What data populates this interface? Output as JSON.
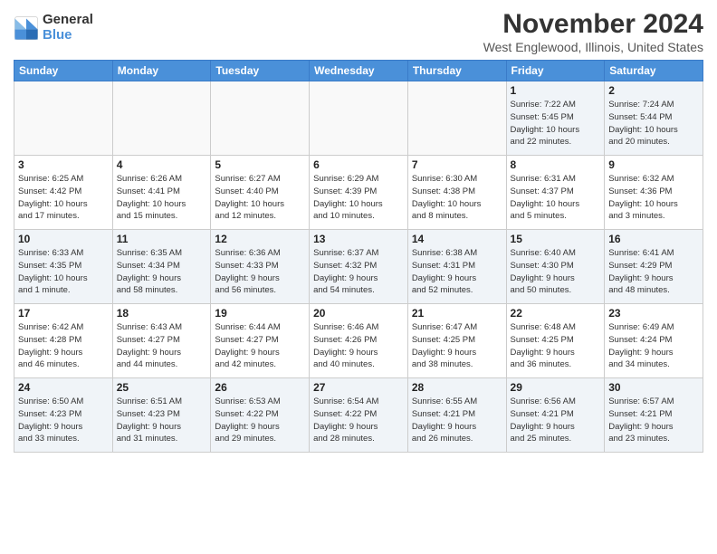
{
  "logo": {
    "general": "General",
    "blue": "Blue"
  },
  "title": "November 2024",
  "location": "West Englewood, Illinois, United States",
  "headers": [
    "Sunday",
    "Monday",
    "Tuesday",
    "Wednesday",
    "Thursday",
    "Friday",
    "Saturday"
  ],
  "weeks": [
    [
      {
        "day": "",
        "info": ""
      },
      {
        "day": "",
        "info": ""
      },
      {
        "day": "",
        "info": ""
      },
      {
        "day": "",
        "info": ""
      },
      {
        "day": "",
        "info": ""
      },
      {
        "day": "1",
        "info": "Sunrise: 7:22 AM\nSunset: 5:45 PM\nDaylight: 10 hours\nand 22 minutes."
      },
      {
        "day": "2",
        "info": "Sunrise: 7:24 AM\nSunset: 5:44 PM\nDaylight: 10 hours\nand 20 minutes."
      }
    ],
    [
      {
        "day": "3",
        "info": "Sunrise: 6:25 AM\nSunset: 4:42 PM\nDaylight: 10 hours\nand 17 minutes."
      },
      {
        "day": "4",
        "info": "Sunrise: 6:26 AM\nSunset: 4:41 PM\nDaylight: 10 hours\nand 15 minutes."
      },
      {
        "day": "5",
        "info": "Sunrise: 6:27 AM\nSunset: 4:40 PM\nDaylight: 10 hours\nand 12 minutes."
      },
      {
        "day": "6",
        "info": "Sunrise: 6:29 AM\nSunset: 4:39 PM\nDaylight: 10 hours\nand 10 minutes."
      },
      {
        "day": "7",
        "info": "Sunrise: 6:30 AM\nSunset: 4:38 PM\nDaylight: 10 hours\nand 8 minutes."
      },
      {
        "day": "8",
        "info": "Sunrise: 6:31 AM\nSunset: 4:37 PM\nDaylight: 10 hours\nand 5 minutes."
      },
      {
        "day": "9",
        "info": "Sunrise: 6:32 AM\nSunset: 4:36 PM\nDaylight: 10 hours\nand 3 minutes."
      }
    ],
    [
      {
        "day": "10",
        "info": "Sunrise: 6:33 AM\nSunset: 4:35 PM\nDaylight: 10 hours\nand 1 minute."
      },
      {
        "day": "11",
        "info": "Sunrise: 6:35 AM\nSunset: 4:34 PM\nDaylight: 9 hours\nand 58 minutes."
      },
      {
        "day": "12",
        "info": "Sunrise: 6:36 AM\nSunset: 4:33 PM\nDaylight: 9 hours\nand 56 minutes."
      },
      {
        "day": "13",
        "info": "Sunrise: 6:37 AM\nSunset: 4:32 PM\nDaylight: 9 hours\nand 54 minutes."
      },
      {
        "day": "14",
        "info": "Sunrise: 6:38 AM\nSunset: 4:31 PM\nDaylight: 9 hours\nand 52 minutes."
      },
      {
        "day": "15",
        "info": "Sunrise: 6:40 AM\nSunset: 4:30 PM\nDaylight: 9 hours\nand 50 minutes."
      },
      {
        "day": "16",
        "info": "Sunrise: 6:41 AM\nSunset: 4:29 PM\nDaylight: 9 hours\nand 48 minutes."
      }
    ],
    [
      {
        "day": "17",
        "info": "Sunrise: 6:42 AM\nSunset: 4:28 PM\nDaylight: 9 hours\nand 46 minutes."
      },
      {
        "day": "18",
        "info": "Sunrise: 6:43 AM\nSunset: 4:27 PM\nDaylight: 9 hours\nand 44 minutes."
      },
      {
        "day": "19",
        "info": "Sunrise: 6:44 AM\nSunset: 4:27 PM\nDaylight: 9 hours\nand 42 minutes."
      },
      {
        "day": "20",
        "info": "Sunrise: 6:46 AM\nSunset: 4:26 PM\nDaylight: 9 hours\nand 40 minutes."
      },
      {
        "day": "21",
        "info": "Sunrise: 6:47 AM\nSunset: 4:25 PM\nDaylight: 9 hours\nand 38 minutes."
      },
      {
        "day": "22",
        "info": "Sunrise: 6:48 AM\nSunset: 4:25 PM\nDaylight: 9 hours\nand 36 minutes."
      },
      {
        "day": "23",
        "info": "Sunrise: 6:49 AM\nSunset: 4:24 PM\nDaylight: 9 hours\nand 34 minutes."
      }
    ],
    [
      {
        "day": "24",
        "info": "Sunrise: 6:50 AM\nSunset: 4:23 PM\nDaylight: 9 hours\nand 33 minutes."
      },
      {
        "day": "25",
        "info": "Sunrise: 6:51 AM\nSunset: 4:23 PM\nDaylight: 9 hours\nand 31 minutes."
      },
      {
        "day": "26",
        "info": "Sunrise: 6:53 AM\nSunset: 4:22 PM\nDaylight: 9 hours\nand 29 minutes."
      },
      {
        "day": "27",
        "info": "Sunrise: 6:54 AM\nSunset: 4:22 PM\nDaylight: 9 hours\nand 28 minutes."
      },
      {
        "day": "28",
        "info": "Sunrise: 6:55 AM\nSunset: 4:21 PM\nDaylight: 9 hours\nand 26 minutes."
      },
      {
        "day": "29",
        "info": "Sunrise: 6:56 AM\nSunset: 4:21 PM\nDaylight: 9 hours\nand 25 minutes."
      },
      {
        "day": "30",
        "info": "Sunrise: 6:57 AM\nSunset: 4:21 PM\nDaylight: 9 hours\nand 23 minutes."
      }
    ]
  ]
}
